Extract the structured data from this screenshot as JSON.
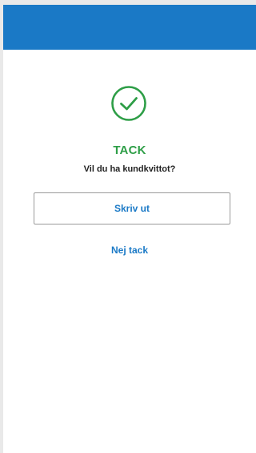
{
  "header": {
    "color": "#1a79c6"
  },
  "confirmation": {
    "icon": "check-circle-icon",
    "icon_color": "#2e9e47",
    "title": "TACK",
    "question": "Vil du ha kundkvittot?"
  },
  "actions": {
    "print_label": "Skriv ut",
    "decline_label": "Nej tack",
    "accent_color": "#1a79c6"
  }
}
